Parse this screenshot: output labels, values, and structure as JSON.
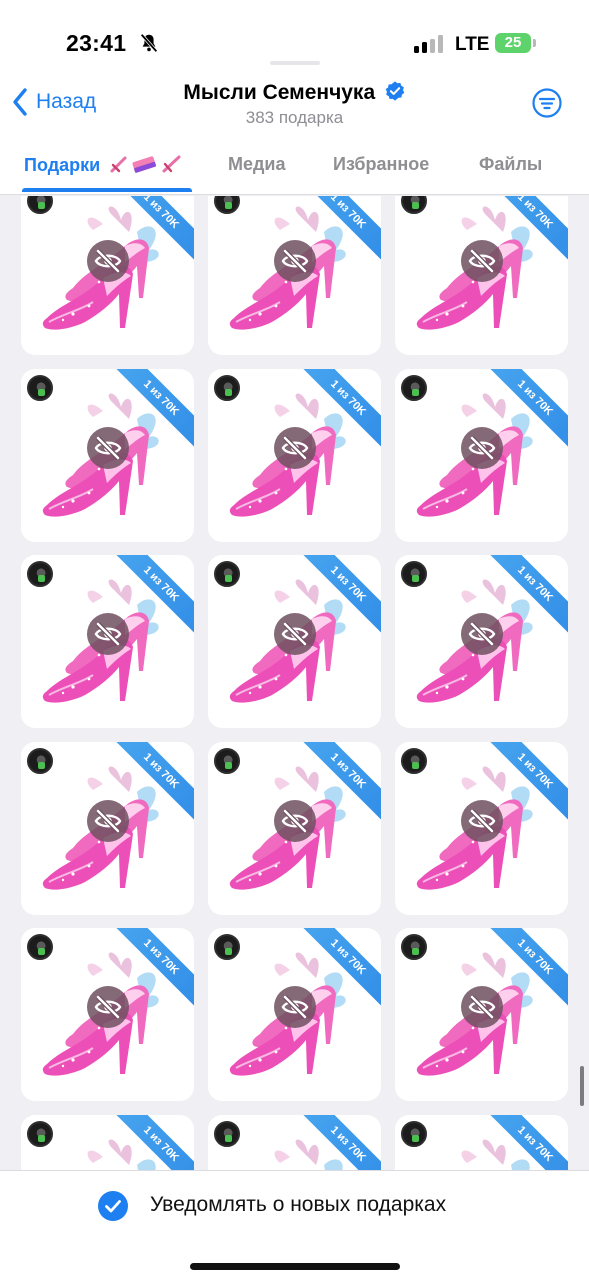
{
  "status_bar": {
    "time": "23:41",
    "network": "LTE",
    "battery": "25",
    "icons": [
      "mute-bell-icon",
      "signal-icon",
      "battery-charging-icon"
    ]
  },
  "header": {
    "back_label": "Назад",
    "title": "Мысли Семенчука",
    "subtitle": "383 подарка",
    "icons": [
      "chevron-left-icon",
      "verified-badge-icon",
      "filter-icon"
    ]
  },
  "tabs": [
    {
      "label": "Подарки",
      "active": true,
      "emoji_icons": [
        "sword-icon",
        "eraser-icon",
        "sword-icon"
      ]
    },
    {
      "label": "Медиа",
      "active": false
    },
    {
      "label": "Избранное",
      "active": false
    },
    {
      "label": "Файлы",
      "active": false
    }
  ],
  "gift_card": {
    "ribbon_text": "1 из 70K",
    "gift_name_icon": "pink-heels-icon",
    "hidden_icon": "eye-slash-icon",
    "rows_visible": 6,
    "columns": 3
  },
  "bottom_bar": {
    "notify_label": "Уведомлять о новых подарках",
    "notify_checked": true
  },
  "colors": {
    "accent": "#1e7ff0",
    "ribbon": "#3b9bed",
    "background": "#f0f0f4",
    "card": "#ffffff",
    "shoe_pink": "#ec4fb8"
  }
}
